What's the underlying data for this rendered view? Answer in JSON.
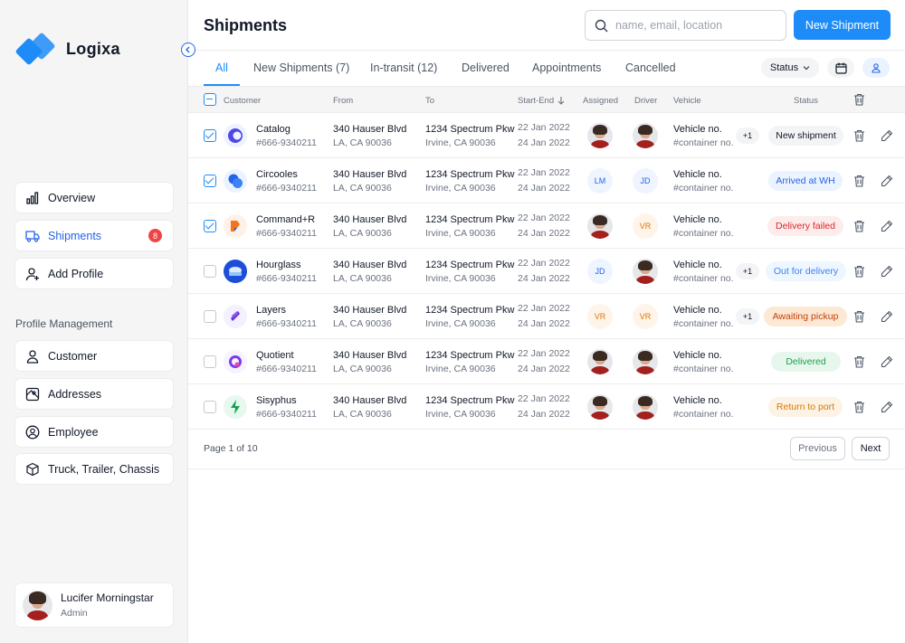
{
  "app": {
    "name": "Logixa"
  },
  "nav": {
    "items": [
      {
        "label": "Overview",
        "icon": "bar-chart-icon"
      },
      {
        "label": "Shipments",
        "icon": "truck-icon",
        "badge": "8"
      },
      {
        "label": "Add Profile",
        "icon": "user-plus-icon"
      }
    ],
    "section_label": "Profile Management",
    "profile_items": [
      {
        "label": "Customer",
        "icon": "user-icon"
      },
      {
        "label": "Addresses",
        "icon": "map-icon"
      },
      {
        "label": "Employee",
        "icon": "user-circle-icon"
      },
      {
        "label": "Truck, Trailer, Chassis",
        "icon": "box-icon"
      }
    ]
  },
  "user": {
    "name": "Lucifer Morningstar",
    "role": "Admin"
  },
  "header": {
    "title": "Shipments",
    "search_placeholder": "name, email, location",
    "new_button": "New Shipment"
  },
  "tabs": [
    "All",
    "New Shipments (7)",
    "In-transit (12)",
    "Delivered",
    "Appointments",
    "Cancelled"
  ],
  "filters": {
    "status_label": "Status"
  },
  "columns": {
    "customer": "Customer",
    "from": "From",
    "to": "To",
    "start_end": "Start-End",
    "assigned": "Assigned",
    "driver": "Driver",
    "vehicle": "Vehicle",
    "status": "Status"
  },
  "rows": [
    {
      "checked": true,
      "name": "Catalog",
      "id": "#666-9340211",
      "from1": "340 Hauser Blvd",
      "from2": "LA, CA 90036",
      "to1": "1234 Spectrum Pkw",
      "to2": "Irvine, CA 90036",
      "start": "22 Jan 2022",
      "end": "24 Jan 2022",
      "assigned": "photo",
      "driver": "photo",
      "vehicle1": "Vehicle no.",
      "vehicle2": "#container no.",
      "extra": "+1",
      "status": "New shipment",
      "status_bg": "#f3f4f6",
      "status_fg": "#111827"
    },
    {
      "checked": true,
      "name": "Circooles",
      "id": "#666-9340211",
      "from1": "340 Hauser Blvd",
      "from2": "LA, CA 90036",
      "to1": "1234 Spectrum Pkw",
      "to2": "Irvine, CA 90036",
      "start": "22 Jan 2022",
      "end": "24 Jan 2022",
      "assigned": "LM",
      "driver": "JD",
      "vehicle1": "Vehicle no.",
      "vehicle2": "#container no.",
      "extra": "",
      "status": "Arrived at WH",
      "status_bg": "#eaf3ff",
      "status_fg": "#2563eb"
    },
    {
      "checked": true,
      "name": "Command+R",
      "id": "#666-9340211",
      "from1": "340 Hauser Blvd",
      "from2": "LA, CA 90036",
      "to1": "1234 Spectrum Pkw",
      "to2": "Irvine, CA 90036",
      "start": "22 Jan 2022",
      "end": "24 Jan 2022",
      "assigned": "photo",
      "driver": "VR",
      "vehicle1": "Vehicle no.",
      "vehicle2": "#container no.",
      "extra": "",
      "status": "Delivery failed",
      "status_bg": "#fdecec",
      "status_fg": "#dc2626"
    },
    {
      "checked": false,
      "name": "Hourglass",
      "id": "#666-9340211",
      "from1": "340 Hauser Blvd",
      "from2": "LA, CA 90036",
      "to1": "1234 Spectrum Pkw",
      "to2": "Irvine, CA 90036",
      "start": "22 Jan 2022",
      "end": "24 Jan 2022",
      "assigned": "JD",
      "driver": "photo",
      "vehicle1": "Vehicle no.",
      "vehicle2": "#container no.",
      "extra": "+1",
      "status": "Out for delivery",
      "status_bg": "#eef6ff",
      "status_fg": "#3b82f6"
    },
    {
      "checked": false,
      "name": "Layers",
      "id": "#666-9340211",
      "from1": "340 Hauser Blvd",
      "from2": "LA, CA 90036",
      "to1": "1234 Spectrum Pkw",
      "to2": "Irvine, CA 90036",
      "start": "22 Jan 2022",
      "end": "24 Jan 2022",
      "assigned": "VR",
      "driver": "VR",
      "vehicle1": "Vehicle no.",
      "vehicle2": "#container no.",
      "extra": "+1",
      "status": "Awaiting pickup",
      "status_bg": "#fde8d4",
      "status_fg": "#c2410c"
    },
    {
      "checked": false,
      "name": "Quotient",
      "id": "#666-9340211",
      "from1": "340 Hauser Blvd",
      "from2": "LA, CA 90036",
      "to1": "1234 Spectrum Pkw",
      "to2": "Irvine, CA 90036",
      "start": "22 Jan 2022",
      "end": "24 Jan 2022",
      "assigned": "photo",
      "driver": "photo",
      "vehicle1": "Vehicle no.",
      "vehicle2": "#container no.",
      "extra": "",
      "status": "Delivered",
      "status_bg": "#e8f7ee",
      "status_fg": "#16a34a"
    },
    {
      "checked": false,
      "name": "Sisyphus",
      "id": "#666-9340211",
      "from1": "340 Hauser Blvd",
      "from2": "LA, CA 90036",
      "to1": "1234 Spectrum Pkw",
      "to2": "Irvine, CA 90036",
      "start": "22 Jan 2022",
      "end": "24 Jan 2022",
      "assigned": "photo",
      "driver": "photo",
      "vehicle1": "Vehicle no.",
      "vehicle2": "#container no.",
      "extra": "",
      "status": "Return to port",
      "status_bg": "#fdf3e4",
      "status_fg": "#d97706"
    }
  ],
  "pagination": {
    "info": "Page 1 of 10",
    "previous": "Previous",
    "next": "Next"
  },
  "colors": {
    "accent": "#1d8cf8",
    "badge": "#ef4444"
  }
}
